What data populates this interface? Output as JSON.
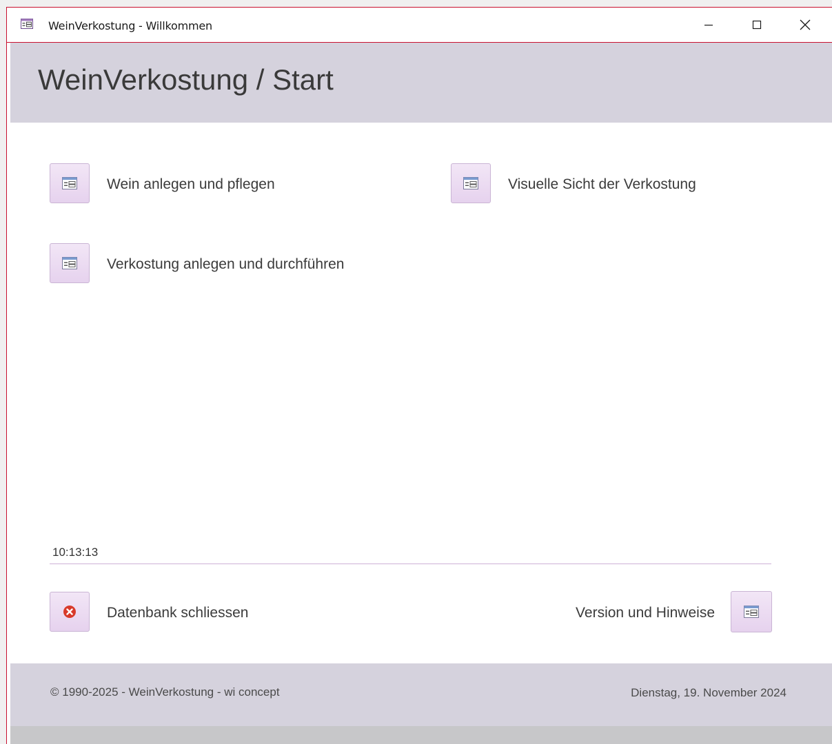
{
  "window": {
    "title": "WeinVerkostung - Willkommen",
    "accent_color": "#c8102e",
    "controls": [
      "minimize-icon",
      "maximize-icon",
      "close-icon"
    ]
  },
  "header": {
    "title": "WeinVerkostung / Start",
    "background": "#d5d2dd"
  },
  "menu": {
    "items": [
      {
        "label": "Wein anlegen und pflegen",
        "icon": "form-icon"
      },
      {
        "label": "Visuelle Sicht der Verkostung",
        "icon": "form-icon"
      },
      {
        "label": "Verkostung anlegen und durchführen",
        "icon": "form-icon"
      }
    ]
  },
  "status": {
    "clock": "10:13:13"
  },
  "actions": {
    "close_db": {
      "label": "Datenbank schliessen",
      "icon": "close-circle-icon",
      "icon_color": "#d83b2b"
    },
    "version": {
      "label": "Version und Hinweise",
      "icon": "form-icon"
    }
  },
  "footer": {
    "copyright": "© 1990-2025 - WeinVerkostung - wi concept",
    "date": "Dienstag, 19. November 2024"
  }
}
